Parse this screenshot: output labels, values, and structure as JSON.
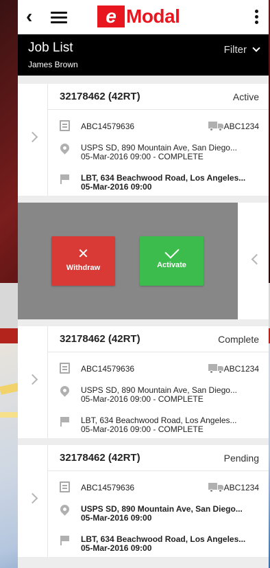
{
  "app": {
    "logo_e": "e",
    "logo_rest": "Modal",
    "page_title": "Job List",
    "user_name": "James Brown",
    "filter_label": "Filter"
  },
  "cards": [
    {
      "job_id": "32178462 (42RT)",
      "status": "Active",
      "ref": "ABC14579636",
      "truck": "ABC1234",
      "pickup_address": "USPS SD, 890 Mountain Ave, San Diego...",
      "pickup_time": "05-Mar-2016 09:00 - COMPLETE",
      "dropoff_address": "LBT, 634 Beachwood Road, Los Angeles...",
      "dropoff_time": "05-Mar-2016 09:00"
    },
    {
      "job_id": "32178462 (42RT)",
      "status": "Complete",
      "ref": "ABC14579636",
      "truck": "ABC1234",
      "pickup_address": "USPS SD, 890 Mountain Ave, San Diego...",
      "pickup_time": "05-Mar-2016 09:00 - COMPLETE",
      "dropoff_address": "LBT, 634 Beachwood Road, Los Angeles...",
      "dropoff_time": "05-Mar-2016 09:00 - COMPLETE"
    },
    {
      "job_id": "32178462 (42RT)",
      "status": "Pending",
      "ref": "ABC14579636",
      "truck": "ABC1234",
      "pickup_address": "USPS SD, 890 Mountain Ave, San Diego...",
      "pickup_time": "05-Mar-2016 09:00",
      "dropoff_address": "LBT, 634 Beachwood Road, Los Angeles...",
      "dropoff_time": "05-Mar-2016 09:00"
    }
  ],
  "swipe_actions": {
    "withdraw_icon": "✕",
    "withdraw_label": "Withdraw",
    "activate_label": "Activate"
  },
  "colors": {
    "brand_red": "#e8161f",
    "withdraw_red": "#d93a35",
    "activate_green": "#3dbc4e",
    "swipe_gray": "#878787"
  }
}
